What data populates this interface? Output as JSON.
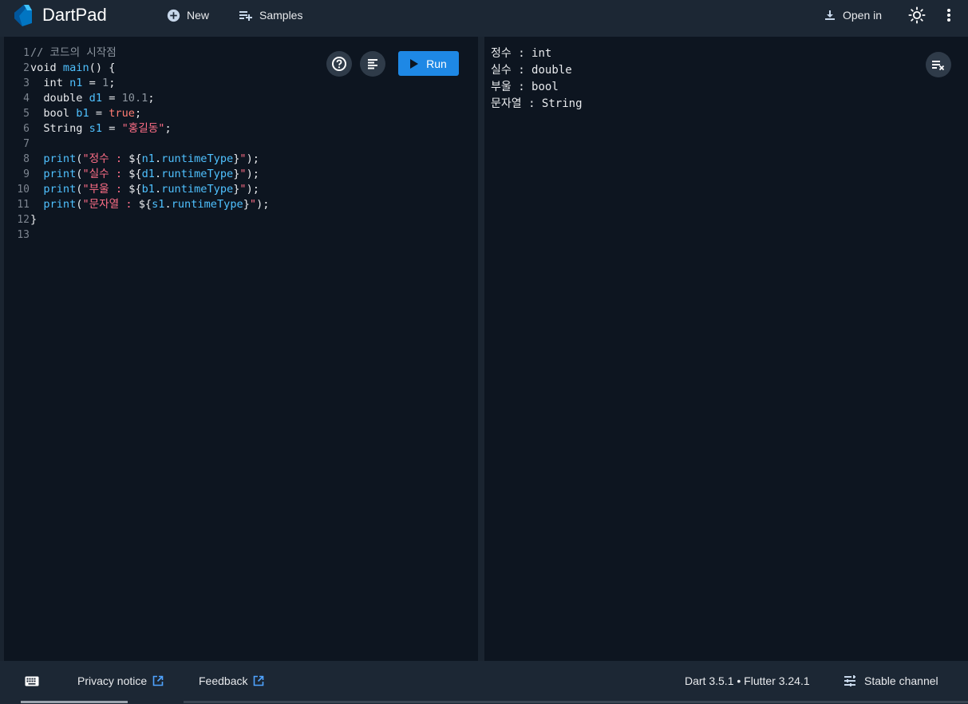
{
  "app": {
    "title": "DartPad"
  },
  "toolbar": {
    "new_label": "New",
    "samples_label": "Samples",
    "open_in_label": "Open in"
  },
  "editor": {
    "run_label": "Run",
    "lines": [
      {
        "n": "1",
        "tokens": [
          [
            "comment",
            "// 코드의 시작점"
          ]
        ]
      },
      {
        "n": "2",
        "tokens": [
          [
            "plain",
            "void "
          ],
          [
            "fn",
            "main"
          ],
          [
            "plain",
            "() {"
          ]
        ]
      },
      {
        "n": "3",
        "tokens": [
          [
            "plain",
            "  int "
          ],
          [
            "var",
            "n1"
          ],
          [
            "plain",
            " = "
          ],
          [
            "num",
            "1"
          ],
          [
            "plain",
            ";"
          ]
        ]
      },
      {
        "n": "4",
        "tokens": [
          [
            "plain",
            "  double "
          ],
          [
            "var",
            "d1"
          ],
          [
            "plain",
            " = "
          ],
          [
            "num",
            "10.1"
          ],
          [
            "plain",
            ";"
          ]
        ]
      },
      {
        "n": "5",
        "tokens": [
          [
            "plain",
            "  bool "
          ],
          [
            "var",
            "b1"
          ],
          [
            "plain",
            " = "
          ],
          [
            "bool",
            "true"
          ],
          [
            "plain",
            ";"
          ]
        ]
      },
      {
        "n": "6",
        "tokens": [
          [
            "plain",
            "  String "
          ],
          [
            "var",
            "s1"
          ],
          [
            "plain",
            " = "
          ],
          [
            "str",
            "\"홍길동\""
          ],
          [
            "plain",
            ";"
          ]
        ]
      },
      {
        "n": "7",
        "tokens": []
      },
      {
        "n": "8",
        "tokens": [
          [
            "plain",
            "  "
          ],
          [
            "fn",
            "print"
          ],
          [
            "plain",
            "("
          ],
          [
            "str",
            "\"정수 : "
          ],
          [
            "interp",
            "${"
          ],
          [
            "var",
            "n1"
          ],
          [
            "plain",
            "."
          ],
          [
            "fn",
            "runtimeType"
          ],
          [
            "interp",
            "}"
          ],
          [
            "str",
            "\""
          ],
          [
            "plain",
            ");"
          ]
        ]
      },
      {
        "n": "9",
        "tokens": [
          [
            "plain",
            "  "
          ],
          [
            "fn",
            "print"
          ],
          [
            "plain",
            "("
          ],
          [
            "str",
            "\"실수 : "
          ],
          [
            "interp",
            "${"
          ],
          [
            "var",
            "d1"
          ],
          [
            "plain",
            "."
          ],
          [
            "fn",
            "runtimeType"
          ],
          [
            "interp",
            "}"
          ],
          [
            "str",
            "\""
          ],
          [
            "plain",
            ");"
          ]
        ]
      },
      {
        "n": "10",
        "tokens": [
          [
            "plain",
            "  "
          ],
          [
            "fn",
            "print"
          ],
          [
            "plain",
            "("
          ],
          [
            "str",
            "\"부울 : "
          ],
          [
            "interp",
            "${"
          ],
          [
            "var",
            "b1"
          ],
          [
            "plain",
            "."
          ],
          [
            "fn",
            "runtimeType"
          ],
          [
            "interp",
            "}"
          ],
          [
            "str",
            "\""
          ],
          [
            "plain",
            ");"
          ]
        ]
      },
      {
        "n": "11",
        "tokens": [
          [
            "plain",
            "  "
          ],
          [
            "fn",
            "print"
          ],
          [
            "plain",
            "("
          ],
          [
            "str",
            "\"문자열 : "
          ],
          [
            "interp",
            "${"
          ],
          [
            "var",
            "s1"
          ],
          [
            "plain",
            "."
          ],
          [
            "fn",
            "runtimeType"
          ],
          [
            "interp",
            "}"
          ],
          [
            "str",
            "\""
          ],
          [
            "plain",
            ");"
          ]
        ]
      },
      {
        "n": "12",
        "tokens": [
          [
            "plain",
            "}"
          ]
        ]
      },
      {
        "n": "13",
        "tokens": []
      }
    ]
  },
  "output": {
    "lines": [
      "정수 : int",
      "실수 : double",
      "부울 : bool",
      "문자열 : String"
    ]
  },
  "footer": {
    "privacy_label": "Privacy notice",
    "feedback_label": "Feedback",
    "version_label": "Dart 3.5.1 • Flutter 3.24.1",
    "channel_label": "Stable channel"
  },
  "icons": {
    "logo": "dart-logo-icon",
    "new": "add-circle-icon",
    "samples": "playlist-add-icon",
    "open_in": "download-icon",
    "theme": "light-mode-icon",
    "more": "more-vert-icon",
    "help": "help-icon",
    "format": "format-align-icon",
    "run": "play-icon",
    "clear": "clear-output-icon",
    "keyboard": "keyboard-icon",
    "external": "open-in-new-icon",
    "channel": "tune-icon"
  },
  "colors": {
    "accent": "#1e88e5",
    "background": "#0d1520",
    "bar": "#1c2734"
  }
}
